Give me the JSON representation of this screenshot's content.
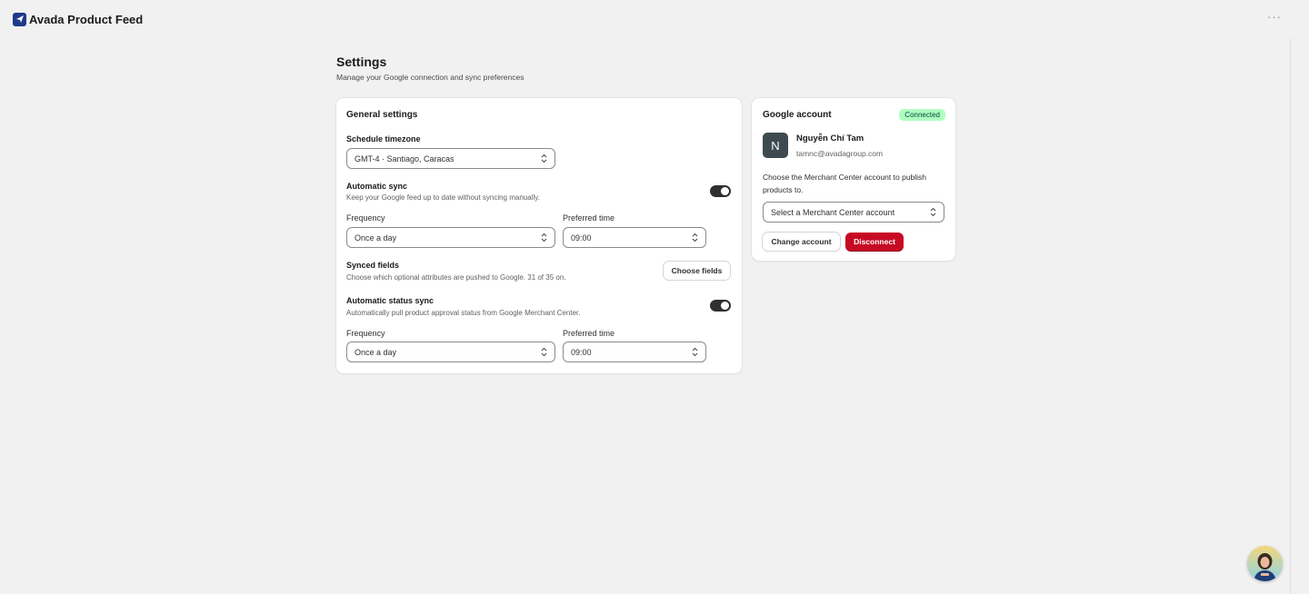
{
  "app": {
    "title": "Avada Product Feed",
    "more_icon": "ellipsis-icon"
  },
  "page": {
    "title": "Settings",
    "subtitle": "Manage your Google connection and sync preferences"
  },
  "general": {
    "heading": "General settings",
    "timezone": {
      "label": "Schedule timezone",
      "value": "GMT-4 · Santiago, Caracas"
    },
    "auto_sync": {
      "label": "Automatic sync",
      "help": "Keep your Google feed up to date without syncing manually.",
      "enabled": true,
      "frequency_label": "Frequency",
      "frequency_value": "Once a day",
      "time_label": "Preferred time",
      "time_value": "09:00"
    },
    "synced_fields": {
      "label": "Synced fields",
      "help": "Choose which optional attributes are pushed to Google. 31 of 35 on.",
      "button": "Choose fields"
    },
    "status_sync": {
      "label": "Automatic status sync",
      "help": "Automatically pull product approval status from Google Merchant Center.",
      "enabled": true,
      "frequency_label": "Frequency",
      "frequency_value": "Once a day",
      "time_label": "Preferred time",
      "time_value": "09:00"
    }
  },
  "google": {
    "heading": "Google account",
    "badge": "Connected",
    "avatar_initial": "N",
    "user_name": "Nguyễn Chí Tam",
    "user_email": "tamnc@avadagroup.com",
    "merchant_prompt": "Choose the Merchant Center account to publish products to.",
    "merchant_select": "Select a Merchant Center account",
    "change_button": "Change account",
    "disconnect_button": "Disconnect"
  },
  "colors": {
    "background": "#f1f1f1",
    "card": "#ffffff",
    "badge_bg": "#affebf",
    "badge_text": "#014b40",
    "critical": "#c70a24",
    "toggle_on": "#303030",
    "avatar": "#3d4b50",
    "brand": "#1f3a8a"
  }
}
